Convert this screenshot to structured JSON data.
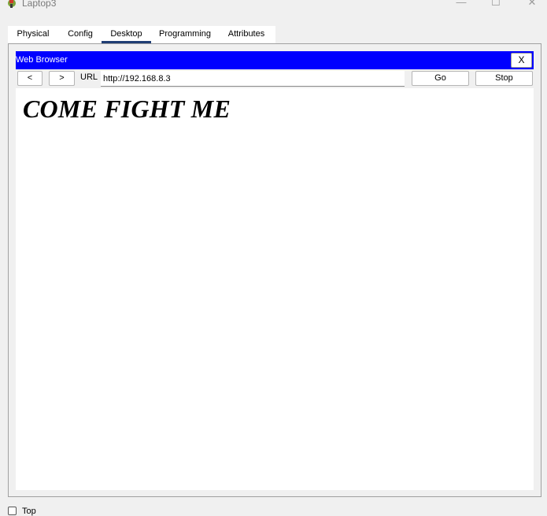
{
  "window": {
    "title": "Laptop3",
    "minimize_glyph": "—",
    "maximize_glyph": "☐",
    "close_glyph": "✕"
  },
  "tabs": [
    {
      "label": "Physical"
    },
    {
      "label": "Config"
    },
    {
      "label": "Desktop",
      "active": true
    },
    {
      "label": "Programming"
    },
    {
      "label": "Attributes"
    }
  ],
  "browser": {
    "title": "Web Browser",
    "close_label": "X",
    "back_label": "<",
    "forward_label": ">",
    "url_label": "URL",
    "url_value": "http://192.168.8.3",
    "go_label": "Go",
    "stop_label": "Stop",
    "header_color": "#0000ff"
  },
  "page": {
    "heading": "COME FIGHT ME"
  },
  "footer": {
    "top_label": "Top",
    "top_checked": false
  }
}
